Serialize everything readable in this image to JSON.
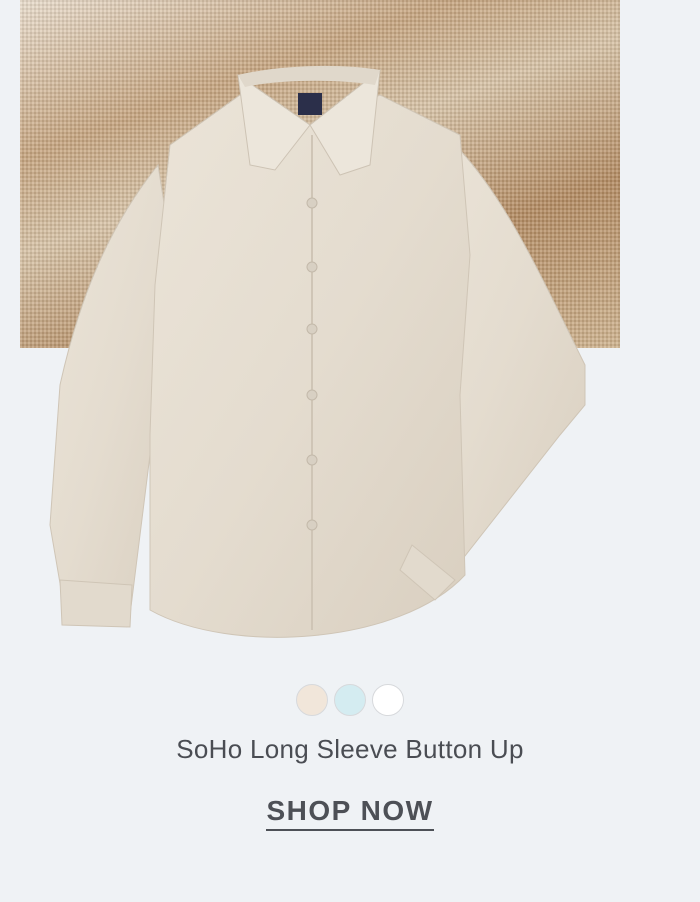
{
  "product": {
    "name": "SoHo Long Sleeve Button Up",
    "image_icon": "shirt-icon",
    "shirt_color": "#e6ddd0"
  },
  "swatches": [
    {
      "color": "#f1e6da"
    },
    {
      "color": "#d4ecf1"
    },
    {
      "color": "#ffffff"
    }
  ],
  "cta": {
    "label": "SHOP NOW"
  }
}
